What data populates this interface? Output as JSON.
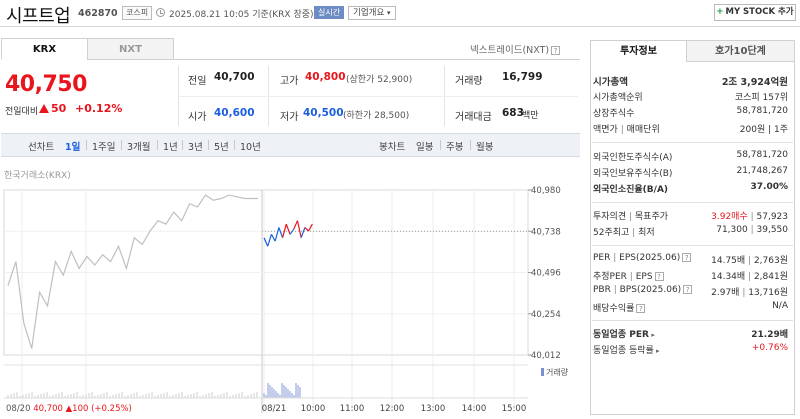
{
  "header": {
    "name": "시프트업",
    "code": "462870",
    "market": "코스피",
    "datetime": "2025.08.21 10:05 기준(KRX 장중)",
    "realtime": "실시간",
    "overview": "기업개요",
    "mystock": "MY STOCK 추가"
  },
  "tabs": {
    "krx": "KRX",
    "nxt": "NXT",
    "nxt_trade": "넥스트레이드(NXT)"
  },
  "price": {
    "current": "40,750",
    "change_label": "전일대비",
    "change": "50",
    "change_pct": "+0.12%"
  },
  "quote": {
    "prev_label": "전일",
    "prev": "40,700",
    "high_label": "고가",
    "high": "40,800",
    "upper": "(상한가 52,900)",
    "volume_label": "거래량",
    "volume": "16,799",
    "open_label": "시가",
    "open": "40,600",
    "low_label": "저가",
    "low": "40,500",
    "lower": "(하한가 28,500)",
    "amount_label": "거래대금",
    "amount": "683",
    "amount_unit": "백만"
  },
  "periods": {
    "items": [
      "선차트",
      "1일",
      "1주일",
      "3개월",
      "1년",
      "3년",
      "5년",
      "10년"
    ],
    "active": "1일",
    "candle": "봉차트",
    "candle_items": [
      "일봉",
      "주봉",
      "월봉"
    ]
  },
  "chart_source": "한국거래소(KRX)",
  "chart_data": {
    "type": "line",
    "y_ticks": [
      "40,980",
      "40,738",
      "40,496",
      "40,254",
      "40,012"
    ],
    "ylim": [
      40012,
      40980
    ],
    "x_ticks": [
      "08/20",
      "08/21",
      "10:00",
      "11:00",
      "12:00",
      "13:00",
      "14:00",
      "15:00"
    ],
    "reference_line": 40738,
    "prev_day_x": [
      "09:00",
      "09:12",
      "09:24",
      "09:36",
      "09:48",
      "10:00",
      "10:12",
      "10:24",
      "10:36",
      "10:48",
      "11:00",
      "11:12",
      "11:24",
      "11:36",
      "11:48",
      "12:00",
      "12:12",
      "12:24",
      "12:36",
      "12:48",
      "13:00",
      "13:12",
      "13:24",
      "13:36",
      "13:48",
      "14:00",
      "14:12",
      "14:24",
      "14:36",
      "14:48",
      "15:00",
      "15:12",
      "15:20"
    ],
    "prev_day_values": [
      40420,
      40560,
      40200,
      40050,
      40380,
      40300,
      40560,
      40480,
      40620,
      40520,
      40590,
      40540,
      40600,
      40560,
      40650,
      40520,
      40700,
      40660,
      40740,
      40800,
      40780,
      40850,
      40800,
      40900,
      40880,
      40950,
      40920,
      40930,
      40950,
      40940,
      40930,
      40930,
      40930
    ],
    "today_x": [
      "09:00",
      "09:05",
      "09:10",
      "09:15",
      "09:20",
      "09:25",
      "09:30",
      "09:35",
      "09:40",
      "09:45",
      "09:50",
      "09:55",
      "10:00",
      "10:05"
    ],
    "today_values": [
      40700,
      40650,
      40720,
      40680,
      40760,
      40700,
      40780,
      40720,
      40750,
      40800,
      40700,
      40760,
      40740,
      40780
    ],
    "volume_label": "거래량",
    "footer_date": "08/20",
    "footer_price": "40,700",
    "footer_change": "100",
    "footer_pct": "(+0.25%)"
  },
  "investment": {
    "tab_info": "투자정보",
    "tab_orderbook": "호가10단계",
    "market_cap_label": "시가총액",
    "market_cap": "2조 3,924억원",
    "market_cap_rank_label": "시가총액순위",
    "market_cap_rank": "코스피 157위",
    "listed_shares_label": "상장주식수",
    "listed_shares": "58,781,720",
    "par_label": "액면가",
    "lot_label": "매매단위",
    "par_lot": "200원 | 1주",
    "foreign_limit_label": "외국인한도주식수(A)",
    "foreign_limit": "58,781,720",
    "foreign_hold_label": "외국인보유주식수(B)",
    "foreign_hold": "21,748,267",
    "foreign_ratio_label": "외국인소진율(B/A)",
    "foreign_ratio": "37.00%",
    "opinion_label": "투자의견",
    "target_label": "목표주가",
    "opinion": "3.92매수",
    "target": "57,923",
    "w52_label": "52주최고",
    "w52_low_label": "최저",
    "w52_high": "71,300",
    "w52_low": "39,550",
    "per_label": "PER",
    "eps_label": "EPS(2025.06)",
    "per": "14.75배",
    "eps": "2,763원",
    "est_per_label": "추정PER",
    "est_eps_label": "EPS",
    "est_per": "14.34배",
    "est_eps": "2,841원",
    "pbr_label": "PBR",
    "bps_label": "BPS(2025.06)",
    "pbr": "2.97배",
    "bps": "13,716원",
    "dividend_label": "배당수익률",
    "dividend": "N/A",
    "sector_per_label": "동일업종 PER",
    "sector_per": "21.29배",
    "sector_chg_label": "동일업종 등락률",
    "sector_chg": "+0.76%"
  }
}
